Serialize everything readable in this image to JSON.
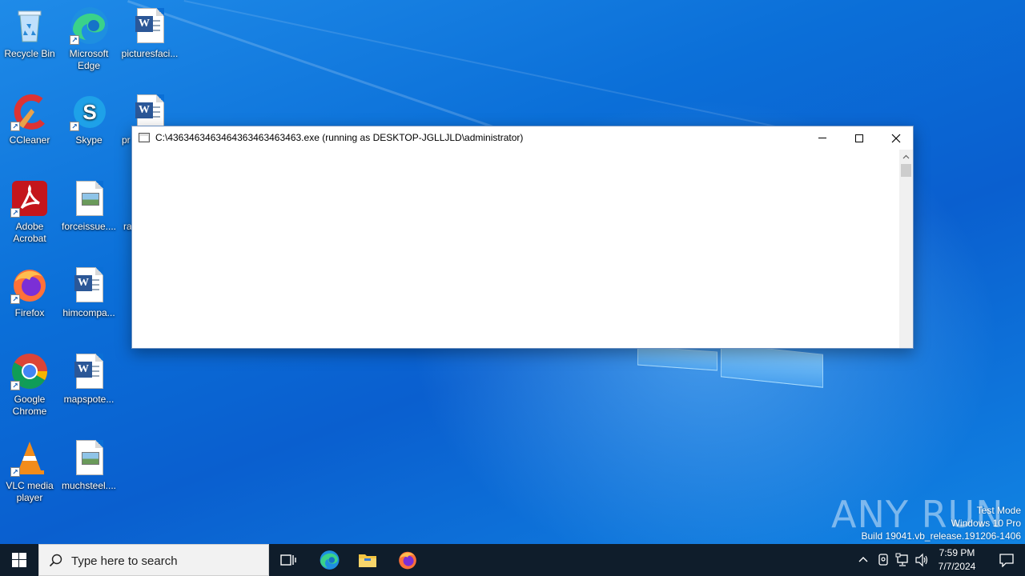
{
  "desktop": {
    "icons": [
      {
        "label": "Recycle Bin"
      },
      {
        "label": "Microsoft Edge"
      },
      {
        "label": "picturesfaci..."
      },
      {
        "label": "CCleaner"
      },
      {
        "label": "Skype"
      },
      {
        "label": "pr"
      },
      {
        "label": "Adobe Acrobat"
      },
      {
        "label": "forceissue...."
      },
      {
        "label": "ra"
      },
      {
        "label": "Firefox"
      },
      {
        "label": "himcompa..."
      },
      {
        "label": "Google Chrome"
      },
      {
        "label": "mapspote..."
      },
      {
        "label": "VLC media player"
      },
      {
        "label": "muchsteel...."
      }
    ]
  },
  "console_window": {
    "title": "C:\\43634634634643634634634 63.exe (running as DESKTOP-JGLLJLD\\administrator)",
    "title_exact": "C:\\4363463463464363463463463.exe (running as DESKTOP-JGLLJLD\\administrator)",
    "minimize_icon": "minimize-icon",
    "maximize_icon": "maximize-icon",
    "close_icon": "close-icon"
  },
  "watermark": {
    "brand": "ANY RUN",
    "mode": "Test Mode",
    "edition": "Windows 10 Pro",
    "build": "Build 19041.vb_release.191206-1406"
  },
  "taskbar": {
    "search_placeholder": "Type here to search",
    "time": "7:59 PM",
    "date": "7/7/2024",
    "apps": [
      "task-view-icon",
      "edge-icon",
      "file-explorer-icon",
      "firefox-icon"
    ]
  },
  "colors": {
    "wallpaper": "#0a6fd6",
    "taskbar": "#0f1d2b"
  }
}
